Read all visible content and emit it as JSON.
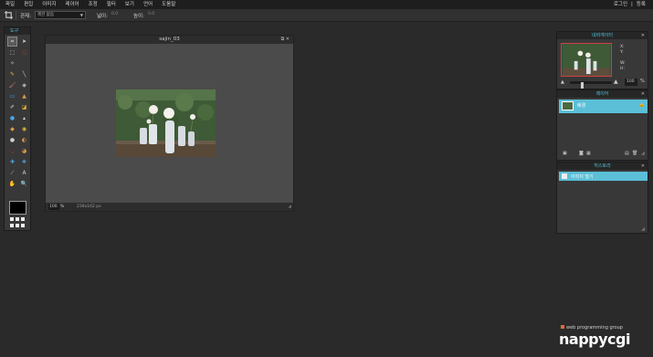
{
  "menubar": {
    "items": [
      "파일",
      "편집",
      "이미지",
      "레이어",
      "조정",
      "필터",
      "보기",
      "언어",
      "도움말"
    ],
    "login": "로그인",
    "sep": "|",
    "signup": "등록"
  },
  "options": {
    "constraint_label": "관제:",
    "constraint_value": "제한 없음",
    "width_label": "넓이:",
    "width_value": "0.0",
    "height_label": "높이:",
    "height_value": "0.0"
  },
  "tools": {
    "title": "도구",
    "items": [
      {
        "name": "crop-tool-icon",
        "glyph": "⌗"
      },
      {
        "name": "move-tool-icon",
        "glyph": "➤"
      },
      {
        "name": "marquee-tool-icon",
        "glyph": "⬚"
      },
      {
        "name": "lasso-tool-icon",
        "glyph": "◌"
      },
      {
        "name": "wand-tool-icon",
        "glyph": "✧"
      },
      {
        "name": "blank-tool-icon",
        "glyph": ""
      },
      {
        "name": "pencil-tool-icon",
        "glyph": "✎"
      },
      {
        "name": "line-tool-icon",
        "glyph": "╲"
      },
      {
        "name": "brush-tool-icon",
        "glyph": "🖌"
      },
      {
        "name": "bucket-tool-icon",
        "glyph": "◈"
      },
      {
        "name": "gradient-tool-icon",
        "glyph": "▭"
      },
      {
        "name": "stamp-tool-icon",
        "glyph": "▲"
      },
      {
        "name": "color-replace-tool-icon",
        "glyph": "✐"
      },
      {
        "name": "eraser-tool-icon",
        "glyph": "◪"
      },
      {
        "name": "drop-tool-icon",
        "glyph": "●"
      },
      {
        "name": "sharpen-tool-icon",
        "glyph": "▴"
      },
      {
        "name": "sponge-tool-icon",
        "glyph": "◆"
      },
      {
        "name": "burn-tool-icon",
        "glyph": "◉"
      },
      {
        "name": "dodge-tool-icon",
        "glyph": "●"
      },
      {
        "name": "smudge-tool-icon",
        "glyph": "◐"
      },
      {
        "name": "redeye-tool-icon",
        "glyph": "◡"
      },
      {
        "name": "bloat-tool-icon",
        "glyph": "◕"
      },
      {
        "name": "pinch-tool-icon",
        "glyph": "✚"
      },
      {
        "name": "spot-heal-tool-icon",
        "glyph": "❖"
      },
      {
        "name": "picker-tool-icon",
        "glyph": "⟋"
      },
      {
        "name": "type-tool-icon",
        "glyph": "A"
      },
      {
        "name": "hand-tool-icon",
        "glyph": "✋"
      },
      {
        "name": "zoom-tool-icon",
        "glyph": "🔍"
      }
    ],
    "fg_color": "#000000",
    "accent": "#4fc3dd"
  },
  "image_window": {
    "title": "sajin_03",
    "zoom": "100",
    "zoom_unit": "%",
    "dimensions": "239x162 px"
  },
  "navigator": {
    "title": "네비게이터",
    "x_label": "X:",
    "y_label": "Y:",
    "w_label": "W:",
    "h_label": "H:",
    "zoom_value": "100",
    "zoom_unit": "%",
    "zoom_fraction": 0.25
  },
  "layers": {
    "title": "레이어",
    "items": [
      {
        "name": "배경",
        "locked": true
      }
    ]
  },
  "history": {
    "title": "히스토리",
    "items": [
      {
        "name": "이미지 열기"
      }
    ]
  },
  "logo": {
    "tagline": "web programming group",
    "brand": "nappycgi"
  }
}
